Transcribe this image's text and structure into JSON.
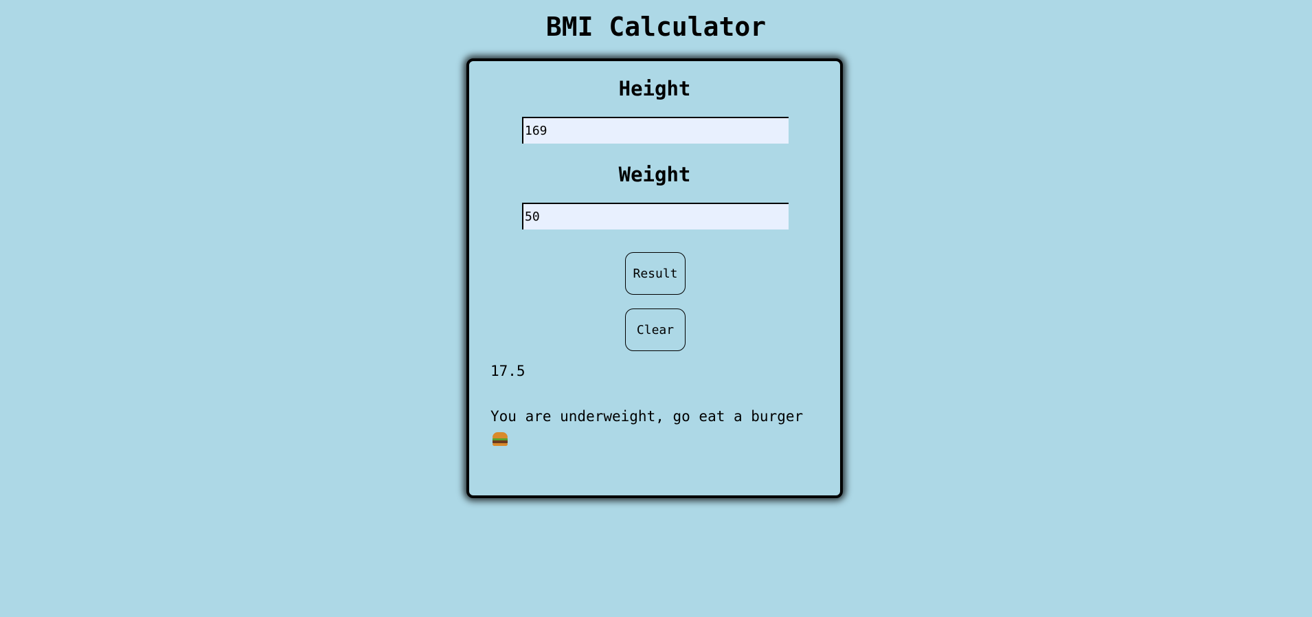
{
  "page": {
    "title": "BMI Calculator",
    "background_color": "#add8e6"
  },
  "form": {
    "height": {
      "label": "Height",
      "value": "169"
    },
    "weight": {
      "label": "Weight",
      "value": "50"
    },
    "result_button_label": "Result",
    "clear_button_label": "Clear"
  },
  "result": {
    "bmi_value": "17.5",
    "message": "You are underweight, go eat a burger",
    "message_icon": "burger-icon"
  }
}
